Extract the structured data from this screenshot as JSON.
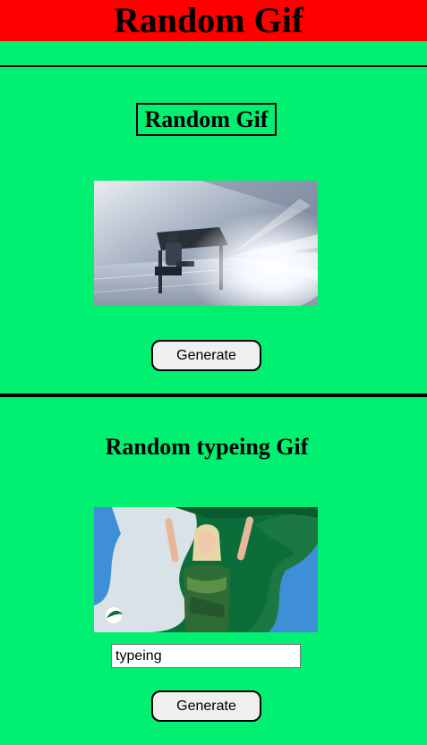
{
  "header": {
    "title": "Random Gif",
    "background": "#ff0000"
  },
  "theme": {
    "page_background": "#02f072"
  },
  "random_section": {
    "title": "Random Gif",
    "generate_label": "Generate"
  },
  "search_section": {
    "title": "Random typeing Gif",
    "search_value": "typeing",
    "generate_label": "Generate"
  }
}
